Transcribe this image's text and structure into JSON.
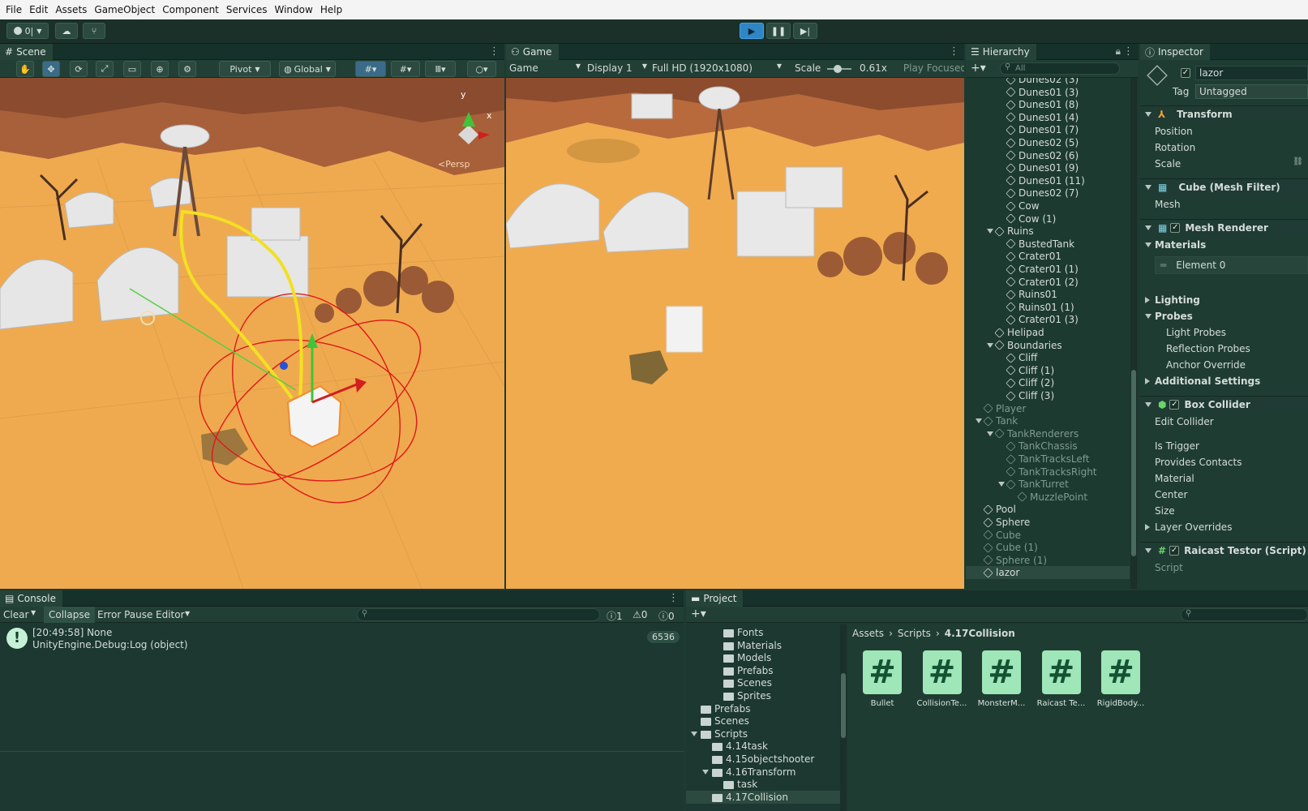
{
  "menu": [
    "File",
    "Edit",
    "Assets",
    "GameObject",
    "Component",
    "Services",
    "Window",
    "Help"
  ],
  "toolbar": {
    "account": "0|"
  },
  "scene": {
    "tab": "Scene",
    "pivot": "Pivot",
    "global": "Global",
    "axis_y": "y",
    "axis_x": "x",
    "persp": "<Persp"
  },
  "game": {
    "tab": "Game",
    "mode": "Game",
    "display": "Display 1",
    "resolution": "Full HD (1920x1080)",
    "scale_label": "Scale",
    "scale_value": "0.61x",
    "play_focused": "Play Focused"
  },
  "hierarchy": {
    "tab": "Hierarchy",
    "search_placeholder": "All",
    "items": [
      {
        "label": "Dunes02 (3)",
        "indent": 3,
        "dim": false
      },
      {
        "label": "Dunes01 (3)",
        "indent": 3,
        "dim": false
      },
      {
        "label": "Dunes01 (8)",
        "indent": 3,
        "dim": false
      },
      {
        "label": "Dunes01 (4)",
        "indent": 3,
        "dim": false
      },
      {
        "label": "Dunes01 (7)",
        "indent": 3,
        "dim": false
      },
      {
        "label": "Dunes02 (5)",
        "indent": 3,
        "dim": false
      },
      {
        "label": "Dunes02 (6)",
        "indent": 3,
        "dim": false
      },
      {
        "label": "Dunes01 (9)",
        "indent": 3,
        "dim": false
      },
      {
        "label": "Dunes01 (11)",
        "indent": 3,
        "dim": false
      },
      {
        "label": "Dunes02 (7)",
        "indent": 3,
        "dim": false
      },
      {
        "label": "Cow",
        "indent": 3,
        "dim": false
      },
      {
        "label": "Cow (1)",
        "indent": 3,
        "dim": false
      },
      {
        "label": "Ruins",
        "indent": 2,
        "dim": false,
        "open": true
      },
      {
        "label": "BustedTank",
        "indent": 3,
        "dim": false
      },
      {
        "label": "Crater01",
        "indent": 3,
        "dim": false
      },
      {
        "label": "Crater01 (1)",
        "indent": 3,
        "dim": false
      },
      {
        "label": "Crater01 (2)",
        "indent": 3,
        "dim": false
      },
      {
        "label": "Ruins01",
        "indent": 3,
        "dim": false
      },
      {
        "label": "Ruins01 (1)",
        "indent": 3,
        "dim": false
      },
      {
        "label": "Crater01 (3)",
        "indent": 3,
        "dim": false
      },
      {
        "label": "Helipad",
        "indent": 2,
        "dim": false
      },
      {
        "label": "Boundaries",
        "indent": 2,
        "dim": false,
        "open": true
      },
      {
        "label": "Cliff",
        "indent": 3,
        "dim": false
      },
      {
        "label": "Cliff (1)",
        "indent": 3,
        "dim": false
      },
      {
        "label": "Cliff (2)",
        "indent": 3,
        "dim": false
      },
      {
        "label": "Cliff (3)",
        "indent": 3,
        "dim": false
      },
      {
        "label": "Player",
        "indent": 1,
        "dim": true
      },
      {
        "label": "Tank",
        "indent": 1,
        "dim": true,
        "open": true
      },
      {
        "label": "TankRenderers",
        "indent": 2,
        "dim": true,
        "open": true
      },
      {
        "label": "TankChassis",
        "indent": 3,
        "dim": true
      },
      {
        "label": "TankTracksLeft",
        "indent": 3,
        "dim": true
      },
      {
        "label": "TankTracksRight",
        "indent": 3,
        "dim": true
      },
      {
        "label": "TankTurret",
        "indent": 3,
        "dim": true,
        "open": true
      },
      {
        "label": "MuzzlePoint",
        "indent": 4,
        "dim": true
      },
      {
        "label": "Pool",
        "indent": 1,
        "dim": false
      },
      {
        "label": "Sphere",
        "indent": 1,
        "dim": false
      },
      {
        "label": "Cube",
        "indent": 1,
        "dim": true
      },
      {
        "label": "Cube (1)",
        "indent": 1,
        "dim": true
      },
      {
        "label": "Sphere (1)",
        "indent": 1,
        "dim": true
      },
      {
        "label": "lazor",
        "indent": 1,
        "dim": false,
        "selected": true
      }
    ]
  },
  "inspector": {
    "tab": "Inspector",
    "object_name": "lazor",
    "tag_label": "Tag",
    "tag_value": "Untagged",
    "transform": "Transform",
    "position": "Position",
    "rotation": "Rotation",
    "scale": "Scale",
    "mesh_filter": "Cube (Mesh Filter)",
    "mesh": "Mesh",
    "mesh_renderer": "Mesh Renderer",
    "materials": "Materials",
    "element0": "Element 0",
    "lighting": "Lighting",
    "probes": "Probes",
    "light_probes": "Light Probes",
    "reflection_probes": "Reflection Probes",
    "anchor_override": "Anchor Override",
    "additional_settings": "Additional Settings",
    "box_collider": "Box Collider",
    "edit_collider": "Edit Collider",
    "is_trigger": "Is Trigger",
    "provides_contacts": "Provides Contacts",
    "material": "Material",
    "center": "Center",
    "size": "Size",
    "layer_overrides": "Layer Overrides",
    "script_comp": "Raicast Testor (Script)",
    "script": "Script"
  },
  "console": {
    "tab": "Console",
    "clear": "Clear",
    "collapse": "Collapse",
    "error_pause": "Error Pause",
    "editor": "Editor",
    "count_log": "1",
    "count_warn": "0",
    "count_error": "0",
    "entry_line1": "[20:49:58] None",
    "entry_line2": "UnityEngine.Debug:Log (object)",
    "entry_count": "6536"
  },
  "project": {
    "tab": "Project",
    "breadcrumb": [
      "Assets",
      "Scripts",
      "4.17Collision"
    ],
    "folders": [
      {
        "label": "Fonts",
        "indent": 3
      },
      {
        "label": "Materials",
        "indent": 3
      },
      {
        "label": "Models",
        "indent": 3
      },
      {
        "label": "Prefabs",
        "indent": 3
      },
      {
        "label": "Scenes",
        "indent": 3
      },
      {
        "label": "Sprites",
        "indent": 3
      },
      {
        "label": "Prefabs",
        "indent": 1
      },
      {
        "label": "Scenes",
        "indent": 1
      },
      {
        "label": "Scripts",
        "indent": 1,
        "open": true
      },
      {
        "label": "4.14task",
        "indent": 2
      },
      {
        "label": "4.15objectshooter",
        "indent": 2
      },
      {
        "label": "4.16Transform",
        "indent": 2,
        "open": true
      },
      {
        "label": "task",
        "indent": 3
      },
      {
        "label": "4.17Collision",
        "indent": 2,
        "selected": true
      }
    ],
    "assets": [
      "Bullet",
      "CollisionTe...",
      "MonsterM...",
      "Raicast Te...",
      "RigidBody..."
    ]
  },
  "colors": {
    "accent": "#3aa0d8",
    "selection": "#2c5a78",
    "bg": "#203e35"
  }
}
